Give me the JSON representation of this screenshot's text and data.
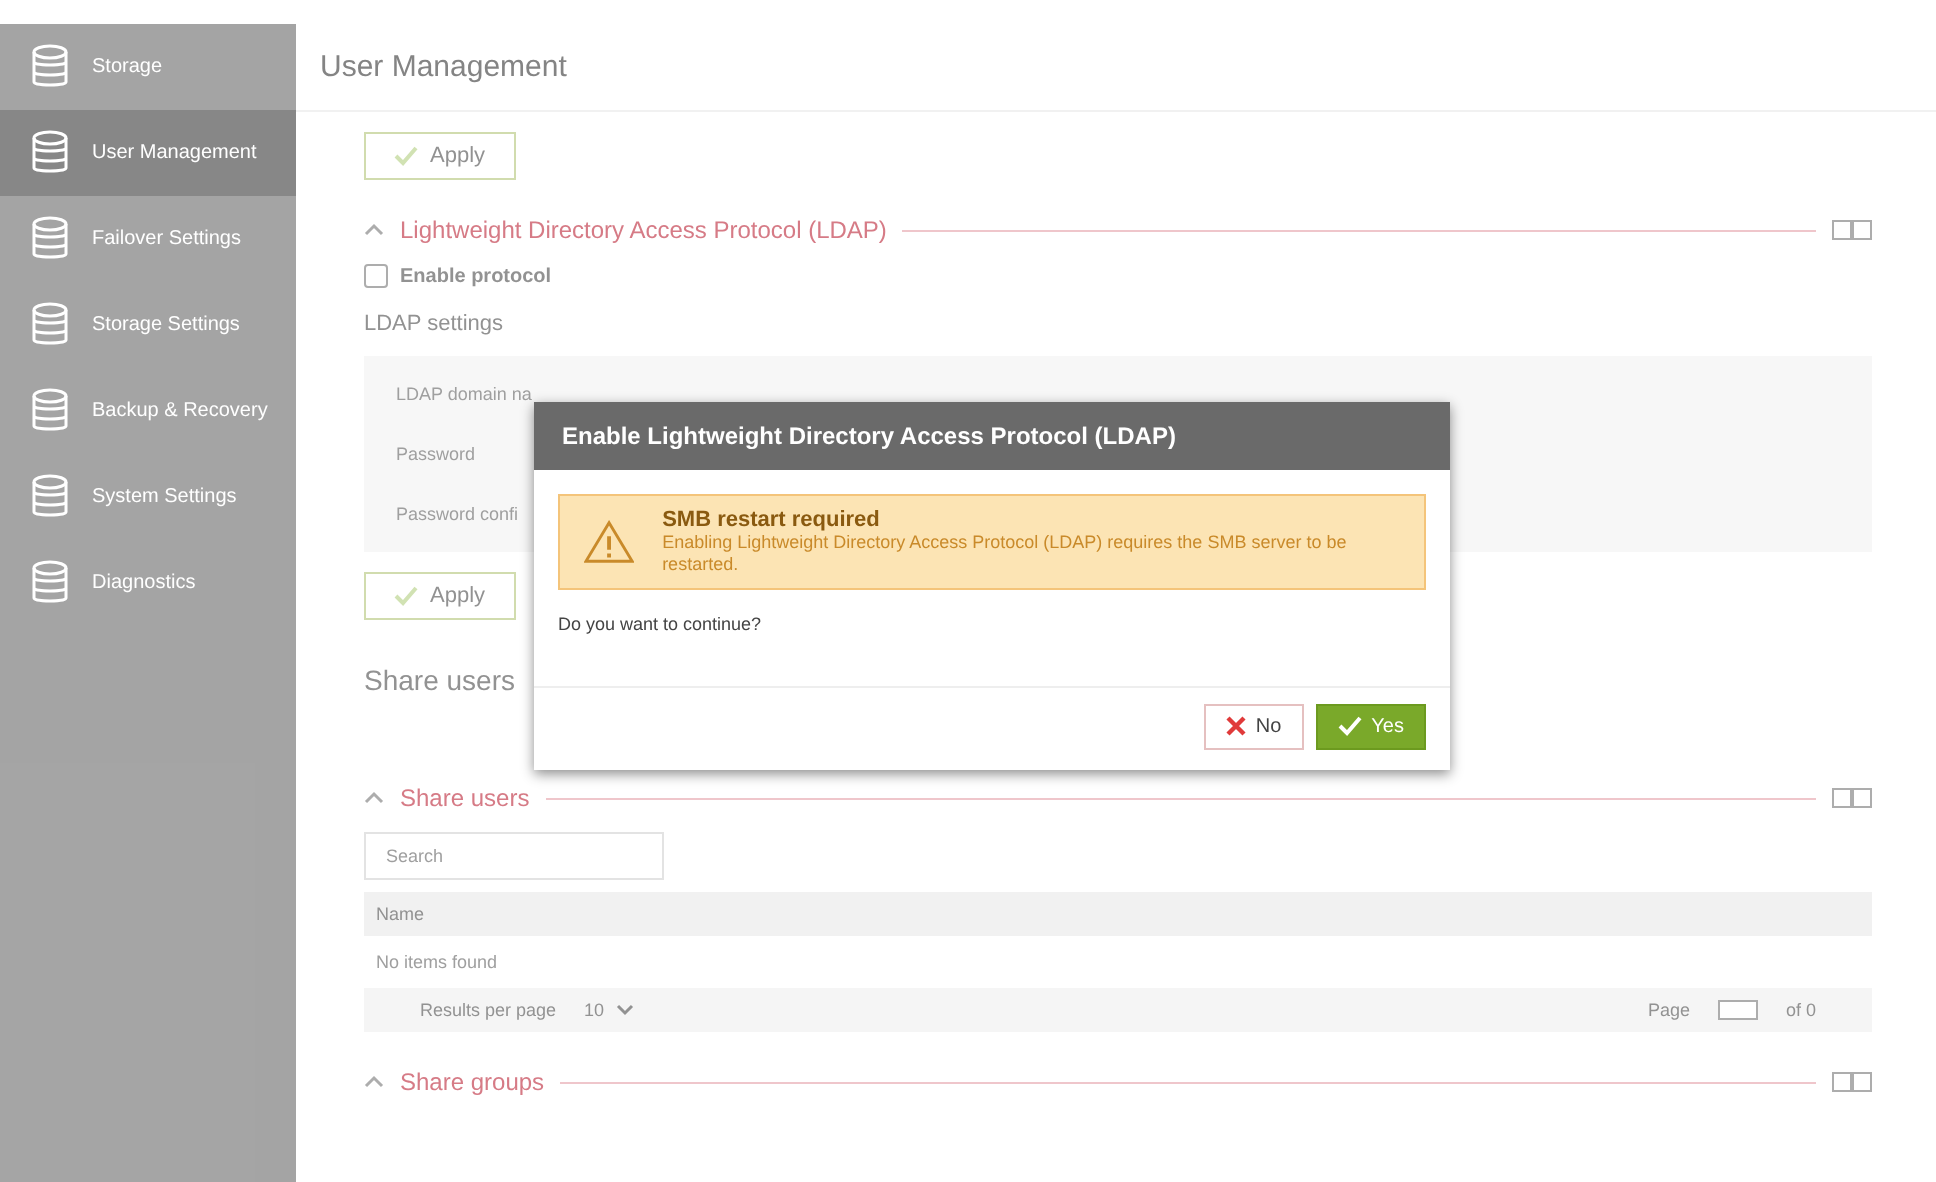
{
  "sidebar": {
    "items": [
      {
        "label": "Storage",
        "selected": false
      },
      {
        "label": "User Management",
        "selected": true
      },
      {
        "label": "Failover Settings",
        "selected": false
      },
      {
        "label": "Storage Settings",
        "selected": false
      },
      {
        "label": "Backup & Recovery",
        "selected": false
      },
      {
        "label": "System Settings",
        "selected": false
      },
      {
        "label": "Diagnostics",
        "selected": false
      }
    ]
  },
  "page": {
    "title": "User Management",
    "apply_top": "Apply",
    "ldap": {
      "title": "Lightweight Directory Access Protocol (LDAP)",
      "expanded": true,
      "enable": {
        "label": "Enable protocol",
        "checked": false
      },
      "settings_title": "LDAP settings",
      "fields": [
        "LDAP domain na",
        "Password",
        "Password confi"
      ],
      "apply": "Apply"
    },
    "share_heading": "Share users",
    "share_users": {
      "title": "Share users",
      "expanded": true,
      "search": {
        "placeholder": "Search"
      },
      "columns": [
        "Name"
      ],
      "empty": "No items found",
      "pager": {
        "results_label": "Results per page",
        "per_page": "10",
        "page_label": "Page",
        "of": "of 0"
      }
    },
    "share_groups": {
      "title": "Share groups",
      "expanded": true
    }
  },
  "dialog": {
    "title": "Enable Lightweight Directory Access Protocol (LDAP)",
    "warning": {
      "title": "SMB restart required",
      "text": "Enabling Lightweight Directory Access Protocol (LDAP) requires the SMB server to be restarted."
    },
    "question": "Do you want to continue?",
    "buttons": [
      {
        "label": "No",
        "kind": "cancel"
      },
      {
        "label": "Yes",
        "kind": "confirm"
      }
    ]
  }
}
